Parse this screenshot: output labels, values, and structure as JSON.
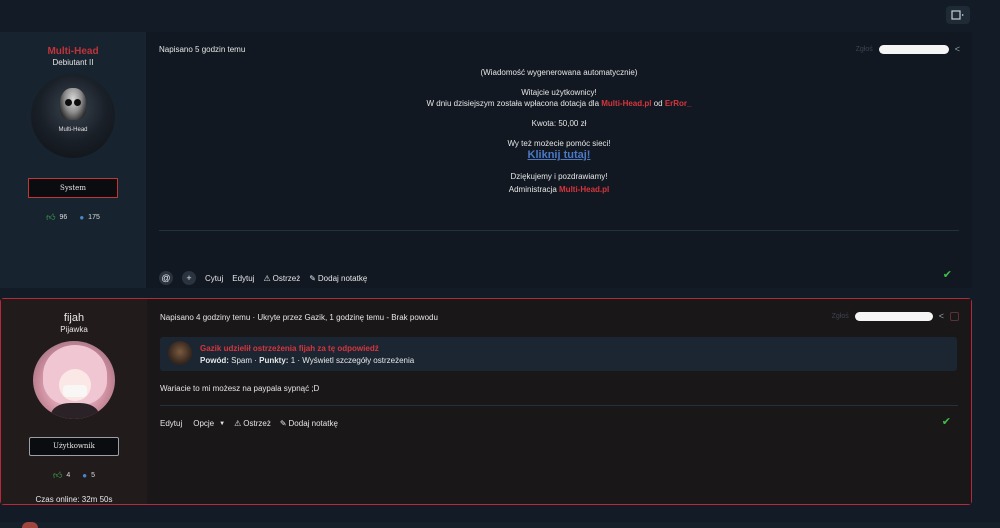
{
  "topbar": {
    "toggle_icon": "panel-toggle-icon"
  },
  "post1": {
    "author": {
      "name": "Multi-Head",
      "title": "Debiutant II",
      "avatar_text": "Multi-Head",
      "rank": "System",
      "likes": "96",
      "messages": "175"
    },
    "meta": "Napisano 5 godzin temu",
    "meta_right_label": "Zgłoś",
    "message": {
      "line1": "(Wiadomość wygenerowana automatycznie)",
      "line2": "Witajcie użytkownicy!",
      "line3_prefix": "W dniu dzisiejszym została wpłacona dotacja dla ",
      "line3_site": "Multi-Head.pl",
      "line3_mid": " od ",
      "line3_user": "ErRor_",
      "line4": "Kwota: 50,00 zł",
      "line5": "Wy też możecie pomóc sieci!",
      "link": "Kliknij tutaj!",
      "line6": "Dziękujemy i pozdrawiamy!",
      "line7_prefix": "Administracja ",
      "line7_site": "Multi-Head.pl"
    },
    "actions": {
      "cite": "Cytuj",
      "edit": "Edytuj",
      "warn": "Ostrzeż",
      "note": "Dodaj notatkę"
    }
  },
  "post2": {
    "author": {
      "name": "fijah",
      "title": "Pijawka",
      "rank": "Użytkownik",
      "likes": "4",
      "messages": "5",
      "online": "Czas online: 32m 50s"
    },
    "meta": "Napisano 4 godziny temu · Ukryte przez Gazik, 1 godzinę temu - Brak powodu",
    "meta_right_label": "Zgłoś",
    "warning": {
      "title": "Gazik udzielił ostrzeżenia fijah za tę odpowiedź",
      "reason_label": "Powód:",
      "reason": " Spam · ",
      "points_label": "Punkty:",
      "points": " 1 · Wyświetl szczegóły ostrzeżenia"
    },
    "text": "Wariacie to mi możesz na paypala sypnąć ;D",
    "actions": {
      "edit": "Edytuj",
      "options": "Opcje",
      "warn": "Ostrzeż",
      "note": "Dodaj notatkę"
    }
  },
  "colors": {
    "accent_red": "#d8353c",
    "link_blue": "#4c78c4",
    "success_green": "#3fbf4a",
    "background": "#131c26"
  }
}
